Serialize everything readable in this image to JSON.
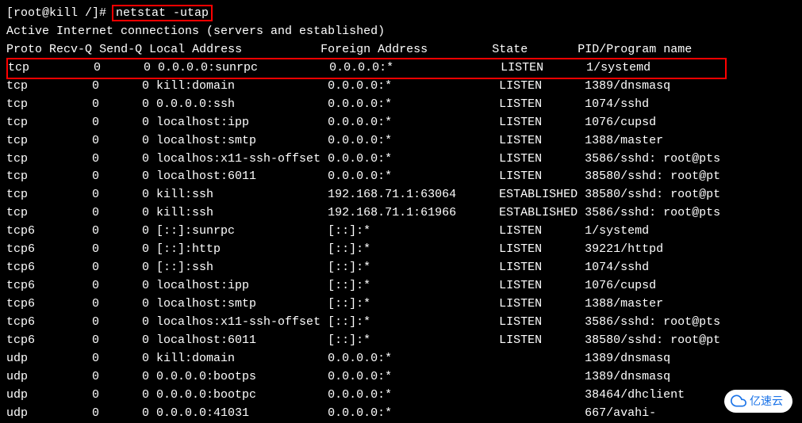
{
  "prompt": {
    "prefix": "[root@kill /]# ",
    "command": "netstat -utap"
  },
  "header": "Active Internet connections (servers and established)",
  "columns": {
    "proto": "Proto",
    "recvq": "Recv-Q",
    "sendq": "Send-Q",
    "local": "Local Address",
    "foreign": "Foreign Address",
    "state": "State",
    "pid": "PID/Program name"
  },
  "rows": [
    {
      "proto": "tcp",
      "recvq": "0",
      "sendq": "0",
      "local": "0.0.0.0:sunrpc",
      "foreign": "0.0.0.0:*",
      "state": "LISTEN",
      "pid": "1/systemd",
      "hl": true
    },
    {
      "proto": "tcp",
      "recvq": "0",
      "sendq": "0",
      "local": "kill:domain",
      "foreign": "0.0.0.0:*",
      "state": "LISTEN",
      "pid": "1389/dnsmasq"
    },
    {
      "proto": "tcp",
      "recvq": "0",
      "sendq": "0",
      "local": "0.0.0.0:ssh",
      "foreign": "0.0.0.0:*",
      "state": "LISTEN",
      "pid": "1074/sshd"
    },
    {
      "proto": "tcp",
      "recvq": "0",
      "sendq": "0",
      "local": "localhost:ipp",
      "foreign": "0.0.0.0:*",
      "state": "LISTEN",
      "pid": "1076/cupsd"
    },
    {
      "proto": "tcp",
      "recvq": "0",
      "sendq": "0",
      "local": "localhost:smtp",
      "foreign": "0.0.0.0:*",
      "state": "LISTEN",
      "pid": "1388/master"
    },
    {
      "proto": "tcp",
      "recvq": "0",
      "sendq": "0",
      "local": "localhos:x11-ssh-offset",
      "foreign": "0.0.0.0:*",
      "state": "LISTEN",
      "pid": "3586/sshd: root@pts"
    },
    {
      "proto": "tcp",
      "recvq": "0",
      "sendq": "0",
      "local": "localhost:6011",
      "foreign": "0.0.0.0:*",
      "state": "LISTEN",
      "pid": "38580/sshd: root@pt"
    },
    {
      "proto": "tcp",
      "recvq": "0",
      "sendq": "0",
      "local": "kill:ssh",
      "foreign": "192.168.71.1:63064",
      "state": "ESTABLISHED",
      "pid": "38580/sshd: root@pt"
    },
    {
      "proto": "tcp",
      "recvq": "0",
      "sendq": "0",
      "local": "kill:ssh",
      "foreign": "192.168.71.1:61966",
      "state": "ESTABLISHED",
      "pid": "3586/sshd: root@pts"
    },
    {
      "proto": "tcp6",
      "recvq": "0",
      "sendq": "0",
      "local": "[::]:sunrpc",
      "foreign": "[::]:*",
      "state": "LISTEN",
      "pid": "1/systemd"
    },
    {
      "proto": "tcp6",
      "recvq": "0",
      "sendq": "0",
      "local": "[::]:http",
      "foreign": "[::]:*",
      "state": "LISTEN",
      "pid": "39221/httpd"
    },
    {
      "proto": "tcp6",
      "recvq": "0",
      "sendq": "0",
      "local": "[::]:ssh",
      "foreign": "[::]:*",
      "state": "LISTEN",
      "pid": "1074/sshd"
    },
    {
      "proto": "tcp6",
      "recvq": "0",
      "sendq": "0",
      "local": "localhost:ipp",
      "foreign": "[::]:*",
      "state": "LISTEN",
      "pid": "1076/cupsd"
    },
    {
      "proto": "tcp6",
      "recvq": "0",
      "sendq": "0",
      "local": "localhost:smtp",
      "foreign": "[::]:*",
      "state": "LISTEN",
      "pid": "1388/master"
    },
    {
      "proto": "tcp6",
      "recvq": "0",
      "sendq": "0",
      "local": "localhos:x11-ssh-offset",
      "foreign": "[::]:*",
      "state": "LISTEN",
      "pid": "3586/sshd: root@pts"
    },
    {
      "proto": "tcp6",
      "recvq": "0",
      "sendq": "0",
      "local": "localhost:6011",
      "foreign": "[::]:*",
      "state": "LISTEN",
      "pid": "38580/sshd: root@pt"
    },
    {
      "proto": "udp",
      "recvq": "0",
      "sendq": "0",
      "local": "kill:domain",
      "foreign": "0.0.0.0:*",
      "state": "",
      "pid": "1389/dnsmasq"
    },
    {
      "proto": "udp",
      "recvq": "0",
      "sendq": "0",
      "local": "0.0.0.0:bootps",
      "foreign": "0.0.0.0:*",
      "state": "",
      "pid": "1389/dnsmasq"
    },
    {
      "proto": "udp",
      "recvq": "0",
      "sendq": "0",
      "local": "0.0.0.0:bootpc",
      "foreign": "0.0.0.0:*",
      "state": "",
      "pid": "38464/dhclient"
    },
    {
      "proto": "udp",
      "recvq": "0",
      "sendq": "0",
      "local": "0.0.0.0:41031",
      "foreign": "0.0.0.0:*",
      "state": "",
      "pid": "667/avahi-"
    }
  ],
  "watermark": "亿速云"
}
